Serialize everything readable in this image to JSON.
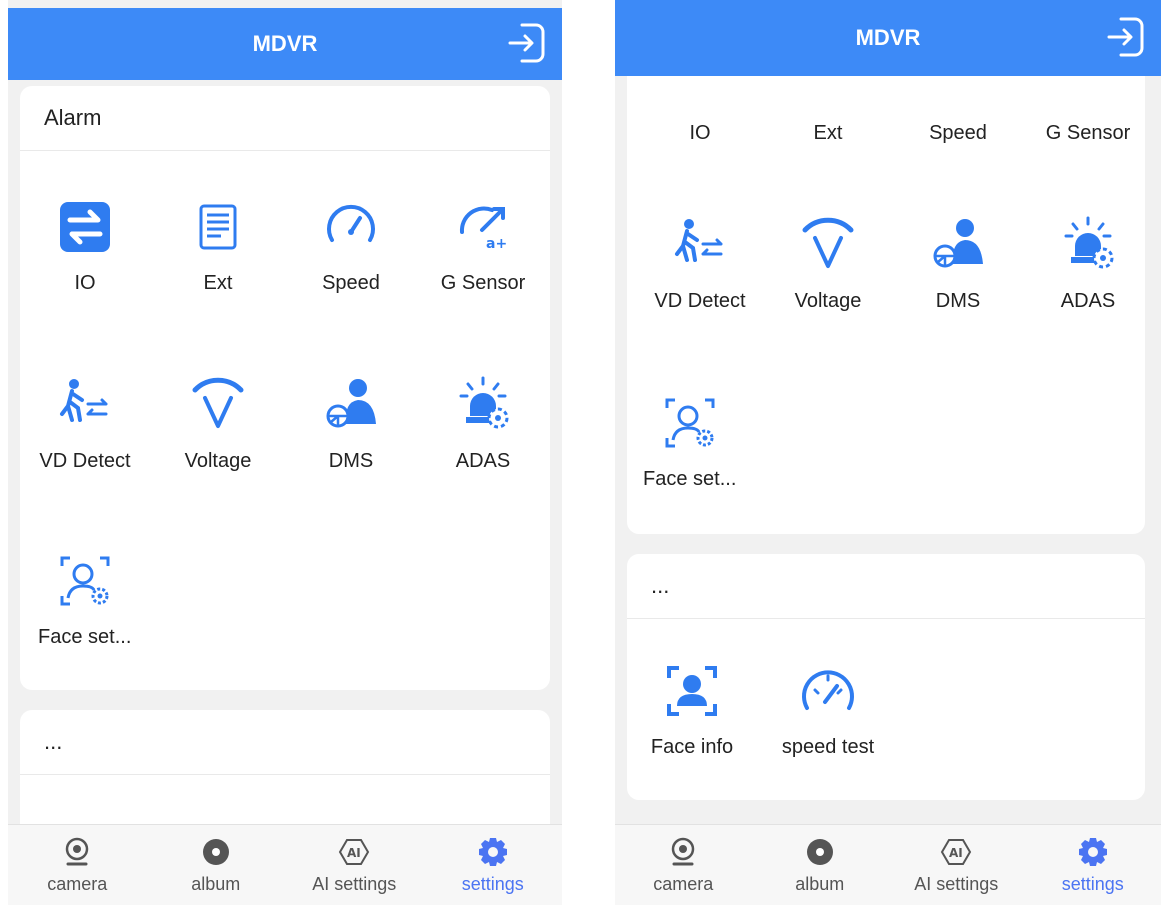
{
  "app_title": "MDVR",
  "colors": {
    "accent": "#3d8af7",
    "active_tab": "#4b74f2",
    "icon_blue": "#2f7cf0"
  },
  "left": {
    "alarm_card": {
      "title": "Alarm",
      "items": [
        {
          "label": "IO",
          "icon": "io-switch-icon"
        },
        {
          "label": "Ext",
          "icon": "ext-document-icon"
        },
        {
          "label": "Speed",
          "icon": "speed-gauge-icon"
        },
        {
          "label": "G Sensor",
          "icon": "g-sensor-icon"
        },
        {
          "label": "VD Detect",
          "icon": "vd-detect-icon"
        },
        {
          "label": "Voltage",
          "icon": "voltage-icon"
        },
        {
          "label": "DMS",
          "icon": "dms-driver-icon"
        },
        {
          "label": "ADAS",
          "icon": "adas-icon"
        },
        {
          "label": "Face set...",
          "icon": "face-set-icon"
        }
      ]
    },
    "more_card": {
      "title": "..."
    }
  },
  "right": {
    "alarm_items": [
      {
        "label": "IO"
      },
      {
        "label": "Ext"
      },
      {
        "label": "Speed"
      },
      {
        "label": "G Sensor"
      },
      {
        "label": "VD Detect",
        "icon": "vd-detect-icon"
      },
      {
        "label": "Voltage",
        "icon": "voltage-icon"
      },
      {
        "label": "DMS",
        "icon": "dms-driver-icon"
      },
      {
        "label": "ADAS",
        "icon": "adas-icon"
      },
      {
        "label": "Face set...",
        "icon": "face-set-icon"
      }
    ],
    "more_card": {
      "title": "...",
      "items": [
        {
          "label": "Face info",
          "icon": "face-info-icon"
        },
        {
          "label": "speed test",
          "icon": "speed-test-icon"
        }
      ]
    }
  },
  "tabs": [
    {
      "label": "camera",
      "icon": "camera-icon",
      "active": false
    },
    {
      "label": "album",
      "icon": "album-icon",
      "active": false
    },
    {
      "label": "AI settings",
      "icon": "ai-settings-icon",
      "active": false
    },
    {
      "label": "settings",
      "icon": "gear-icon",
      "active": true
    }
  ]
}
